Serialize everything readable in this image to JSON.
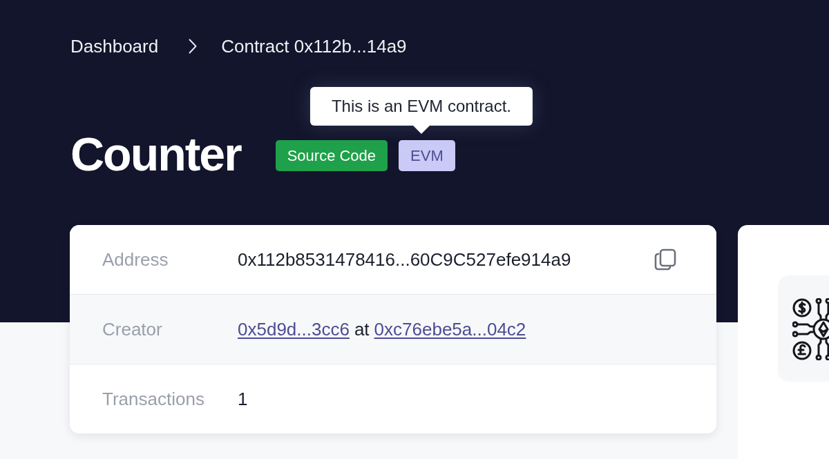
{
  "breadcrumb": [
    {
      "label": "Dashboard"
    },
    {
      "label": "Contract 0x112b...14a9"
    }
  ],
  "title": "Counter",
  "badges": [
    {
      "label": "Source Code",
      "kind": "source"
    },
    {
      "label": "EVM",
      "kind": "vm",
      "tooltip": "This is an EVM contract."
    }
  ],
  "details": [
    {
      "label": "Address",
      "kind": "copyable",
      "value": "0x112b8531478416...60C9C527efe914a9"
    },
    {
      "label": "Creator",
      "kind": "parts",
      "parts": [
        {
          "text": "0x5d9d...3cc6",
          "link": true
        },
        {
          "text": "at",
          "link": false
        },
        {
          "text": "0xc76ebe5a...04c2",
          "link": true
        }
      ]
    },
    {
      "label": "Transactions",
      "kind": "text",
      "value": "1"
    }
  ]
}
